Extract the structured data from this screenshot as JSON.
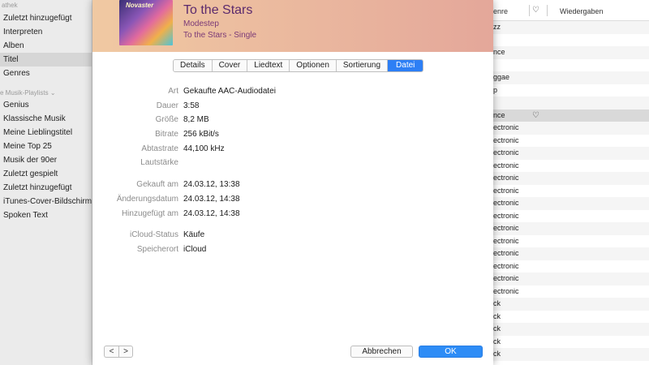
{
  "sidebar": {
    "section_head": "athek",
    "library_items": [
      {
        "label": "Zuletzt hinzugefügt"
      },
      {
        "label": "Interpreten"
      },
      {
        "label": "Alben"
      },
      {
        "label": "Titel",
        "selected": true
      },
      {
        "label": "Genres"
      }
    ],
    "playlists_head": "e Musik-Playlists",
    "playlist_items": [
      {
        "label": "Genius"
      },
      {
        "label": "Klassische Musik"
      },
      {
        "label": "Meine Lieblingstitel"
      },
      {
        "label": "Meine Top 25"
      },
      {
        "label": "Musik der 90er"
      },
      {
        "label": "Zuletzt gespielt"
      },
      {
        "label": "Zuletzt hinzugefügt"
      },
      {
        "label": "iTunes-Cover-Bildschirms"
      },
      {
        "label": "Spoken Text"
      }
    ]
  },
  "songlist": {
    "col_genre": "enre",
    "col_plays": "Wiedergaben",
    "rows": [
      "zz",
      "",
      "nce",
      "",
      "ggae",
      "p",
      "",
      "nce",
      "ectronic",
      "ectronic",
      "ectronic",
      "ectronic",
      "ectronic",
      "ectronic",
      "ectronic",
      "ectronic",
      "ectronic",
      "ectronic",
      "ectronic",
      "ectronic",
      "ectronic",
      "ectronic",
      "ck",
      "ck",
      "ck",
      "ck",
      "ck"
    ]
  },
  "dialog": {
    "cover_text": "Novaster",
    "title": "To the Stars",
    "artist": "Modestep",
    "album": "To the Stars - Single",
    "tabs": [
      {
        "label": "Details"
      },
      {
        "label": "Cover"
      },
      {
        "label": "Liedtext"
      },
      {
        "label": "Optionen"
      },
      {
        "label": "Sortierung"
      },
      {
        "label": "Datei",
        "active": true
      }
    ],
    "fields": {
      "art_label": "Art",
      "art_value": "Gekaufte AAC-Audiodatei",
      "dauer_label": "Dauer",
      "dauer_value": "3:58",
      "groesse_label": "Größe",
      "groesse_value": "8,2 MB",
      "bitrate_label": "Bitrate",
      "bitrate_value": "256 kBit/s",
      "abtastrate_label": "Abtastrate",
      "abtastrate_value": "44,100 kHz",
      "lautstaerke_label": "Lautstärke",
      "lautstaerke_value": "",
      "gekauft_label": "Gekauft am",
      "gekauft_value": "24.03.12, 13:38",
      "aenderung_label": "Änderungsdatum",
      "aenderung_value": "24.03.12, 14:38",
      "hinzugefuegt_label": "Hinzugefügt am",
      "hinzugefuegt_value": "24.03.12, 14:38",
      "icloud_label": "iCloud-Status",
      "icloud_value": "Käufe",
      "speicherort_label": "Speicherort",
      "speicherort_value": "iCloud"
    },
    "prev_glyph": "<",
    "next_glyph": ">",
    "cancel_label": "Abbrechen",
    "ok_label": "OK"
  }
}
